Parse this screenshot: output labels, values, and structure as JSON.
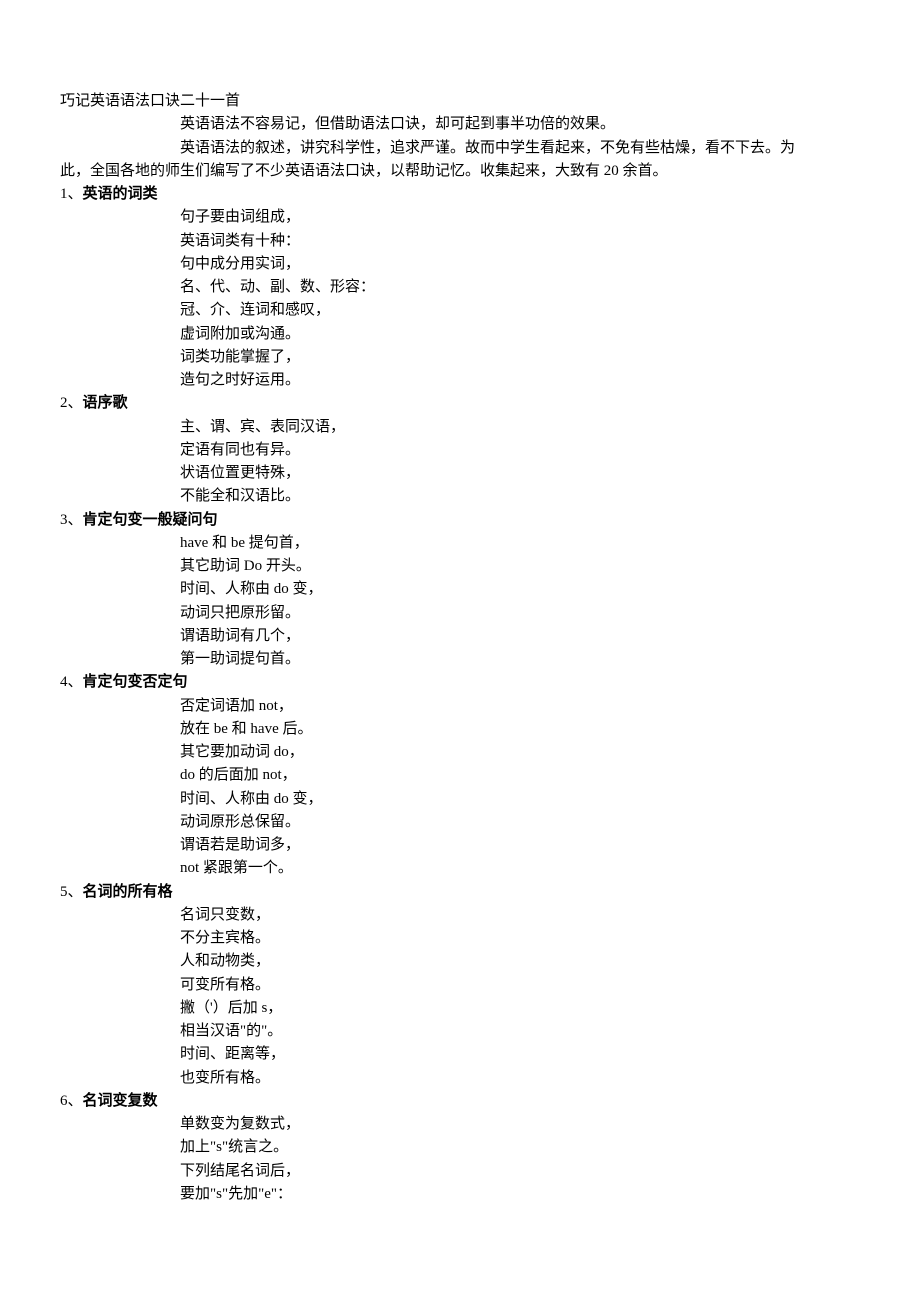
{
  "title": "巧记英语语法口诀二十一首",
  "intro_line1": "英语语法不容易记，但借助语法口诀，却可起到事半功倍的效果。",
  "intro_line2": "英语语法的叙述，讲究科学性，追求严谨。故而中学生看起来，不免有些枯燥，看不下去。为",
  "intro_line3": "此，全国各地的师生们编写了不少英语语法口诀，以帮助记忆。收集起来，大致有 20 余首。",
  "sections": [
    {
      "num": "1、",
      "heading": "英语的词类",
      "lines": [
        "句子要由词组成，",
        "英语词类有十种：",
        "句中成分用实词，",
        "名、代、动、副、数、形容：",
        "冠、介、连词和感叹，",
        "虚词附加或沟通。",
        "词类功能掌握了，",
        "造句之时好运用。"
      ]
    },
    {
      "num": "2、",
      "heading": "语序歌",
      "lines": [
        "主、谓、宾、表同汉语，",
        "定语有同也有异。",
        "状语位置更特殊，",
        "不能全和汉语比。"
      ]
    },
    {
      "num": "3、",
      "heading": "肯定句变一般疑问句",
      "lines": [
        "have 和 be 提句首，",
        "其它助词 Do 开头。",
        "时间、人称由 do 变，",
        "动词只把原形留。",
        "谓语助词有几个，",
        "第一助词提句首。"
      ]
    },
    {
      "num": "4、",
      "heading": "肯定句变否定句",
      "lines": [
        "否定词语加 not，",
        "放在 be 和 have 后。",
        "其它要加动词 do，",
        "do 的后面加 not，",
        "时间、人称由 do 变，",
        "动词原形总保留。",
        "谓语若是助词多，",
        "not 紧跟第一个。"
      ]
    },
    {
      "num": "5、",
      "heading": "名词的所有格",
      "lines": [
        "名词只变数，",
        "不分主宾格。",
        "人和动物类，",
        "可变所有格。",
        "撇（'）后加 s，",
        "相当汉语\"的\"。",
        "时间、距离等，",
        "也变所有格。"
      ]
    },
    {
      "num": "6、",
      "heading": "名词变复数",
      "lines": [
        "单数变为复数式，",
        "加上\"s\"统言之。",
        "下列结尾名词后，",
        "要加\"s\"先加\"e\"："
      ]
    }
  ]
}
